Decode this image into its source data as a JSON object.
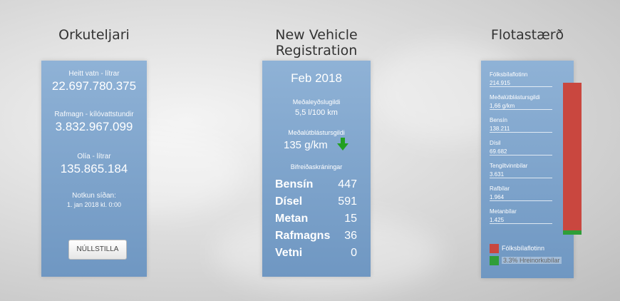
{
  "col1": {
    "title": "Orkuteljari",
    "hot_water_label": "Heitt vatn - lítrar",
    "hot_water_value": "22.697.780.375",
    "power_label": "Rafmagn - kílóvattstundir",
    "power_value": "3.832.967.099",
    "oil_label": "Olía - lítrar",
    "oil_value": "135.865.184",
    "since_label": "Notkun síðan:",
    "since_value": "1. jan 2018 kl. 0:00",
    "reset_label": "NÚLLSTILLA"
  },
  "col2": {
    "title": "New Vehicle Registration",
    "date": "Feb 2018",
    "avg_consumption_label": "Meðaleyðslugildi",
    "avg_consumption_value": "5,5 l/100 km",
    "avg_emission_label": "Meðalútblástursgildi",
    "avg_emission_value": "135 g/km",
    "trend_icon": "arrow-down-icon",
    "registrations_label": "Bifreiðaskráningar",
    "rows": [
      {
        "label": "Bensín",
        "value": "447"
      },
      {
        "label": "Dísel",
        "value": "591"
      },
      {
        "label": "Metan",
        "value": "15"
      },
      {
        "label": "Rafmagns",
        "value": "36"
      },
      {
        "label": "Vetni",
        "value": "0"
      }
    ]
  },
  "col3": {
    "title": "Flotastærð",
    "stats": [
      {
        "label": "Fólksbílaflotinn",
        "value": "214.915"
      },
      {
        "label": "Meðalútblástursgildi",
        "value": "1,66 g/km"
      },
      {
        "label": "Bensín",
        "value": "138.211"
      },
      {
        "label": "Dísil",
        "value": "69.682"
      },
      {
        "label": "Tengiltvinnbílar",
        "value": "3.631"
      },
      {
        "label": "Rafbílar",
        "value": "1.964"
      },
      {
        "label": "Metanbílar",
        "value": "1.425"
      }
    ],
    "legend_red": "Fólksbílaflotinn",
    "legend_green": "3.3% Hreinorkubílar",
    "colors": {
      "red": "#c9473f",
      "green": "#2f9e38"
    },
    "clean_share_percent": 3.3
  }
}
